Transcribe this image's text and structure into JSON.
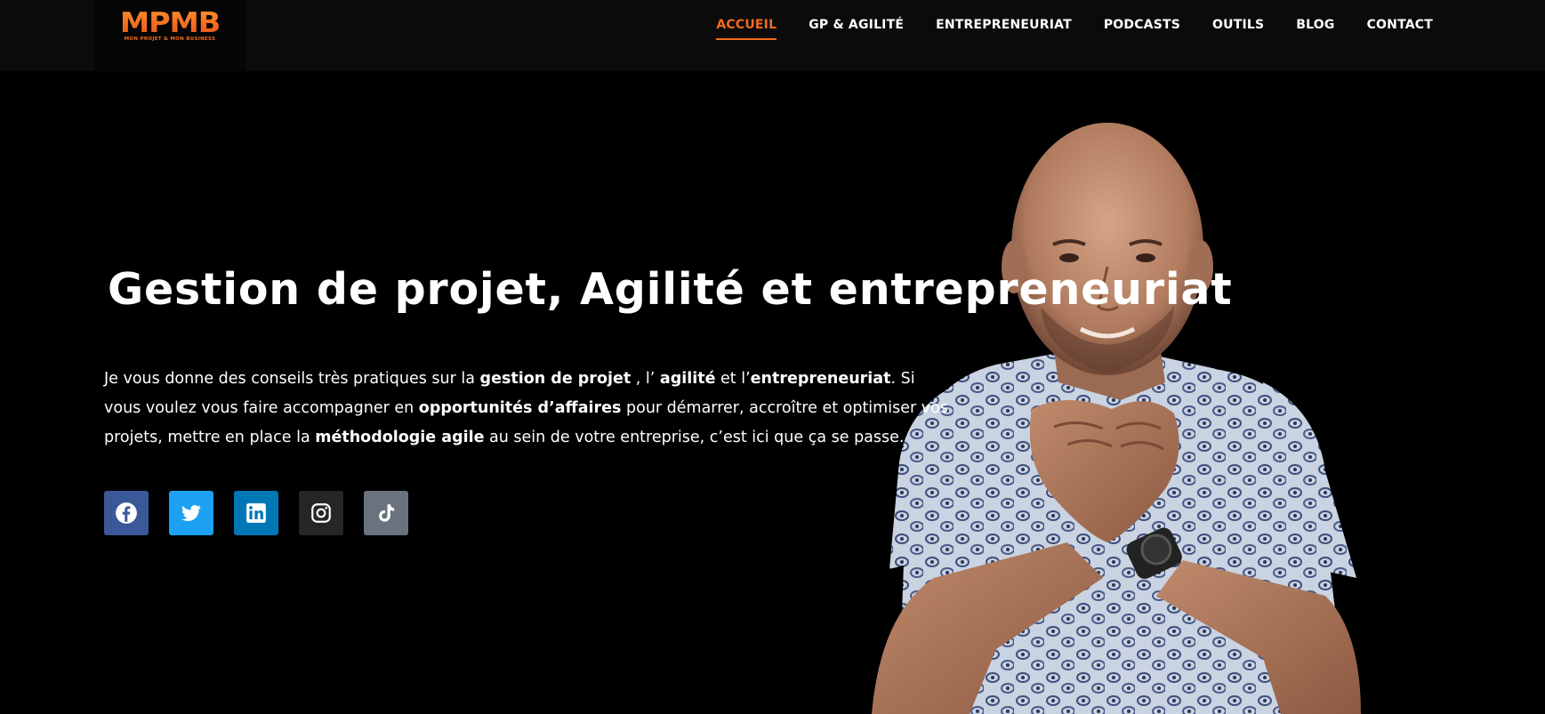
{
  "logo": {
    "mark": "MPMB",
    "tagline": "MON PROJET & MON BUSINESS"
  },
  "nav": {
    "items": [
      {
        "label": "ACCUEIL",
        "active": true
      },
      {
        "label": "GP & AGILITÉ",
        "active": false
      },
      {
        "label": "ENTREPRENEURIAT",
        "active": false
      },
      {
        "label": "PODCASTS",
        "active": false
      },
      {
        "label": "OUTILS",
        "active": false
      },
      {
        "label": "BLOG",
        "active": false
      },
      {
        "label": "CONTACT",
        "active": false
      }
    ]
  },
  "hero": {
    "title": "Gestion de projet, Agilité et entrepreneuriat",
    "paragraph": {
      "t1": "Je vous donne des conseils très pratiques sur la ",
      "b1": "gestion de projet",
      "t2": " , l’ ",
      "b2": "agilité",
      "t3": " et l’",
      "b3": "entrepreneuriat",
      "t4": ". Si vous voulez vous faire accompagner en ",
      "b4": "opportunités d’affaires",
      "t5": " pour démarrer, accroître et optimiser vos projets, mettre en place la ",
      "b5": "méthodologie agile",
      "t6": " au sein de votre entreprise, c’est ici que ça se passe."
    }
  },
  "socials": [
    {
      "name": "facebook-icon",
      "color": "#3b5998"
    },
    {
      "name": "twitter-icon",
      "color": "#1da1f2"
    },
    {
      "name": "linkedin-icon",
      "color": "#0077b5"
    },
    {
      "name": "instagram-icon",
      "color": "#262626"
    },
    {
      "name": "tiktok-icon",
      "color": "#69727d"
    }
  ],
  "colors": {
    "accent": "#f26b1d",
    "background": "#000000",
    "header": "#0b0b0b"
  }
}
